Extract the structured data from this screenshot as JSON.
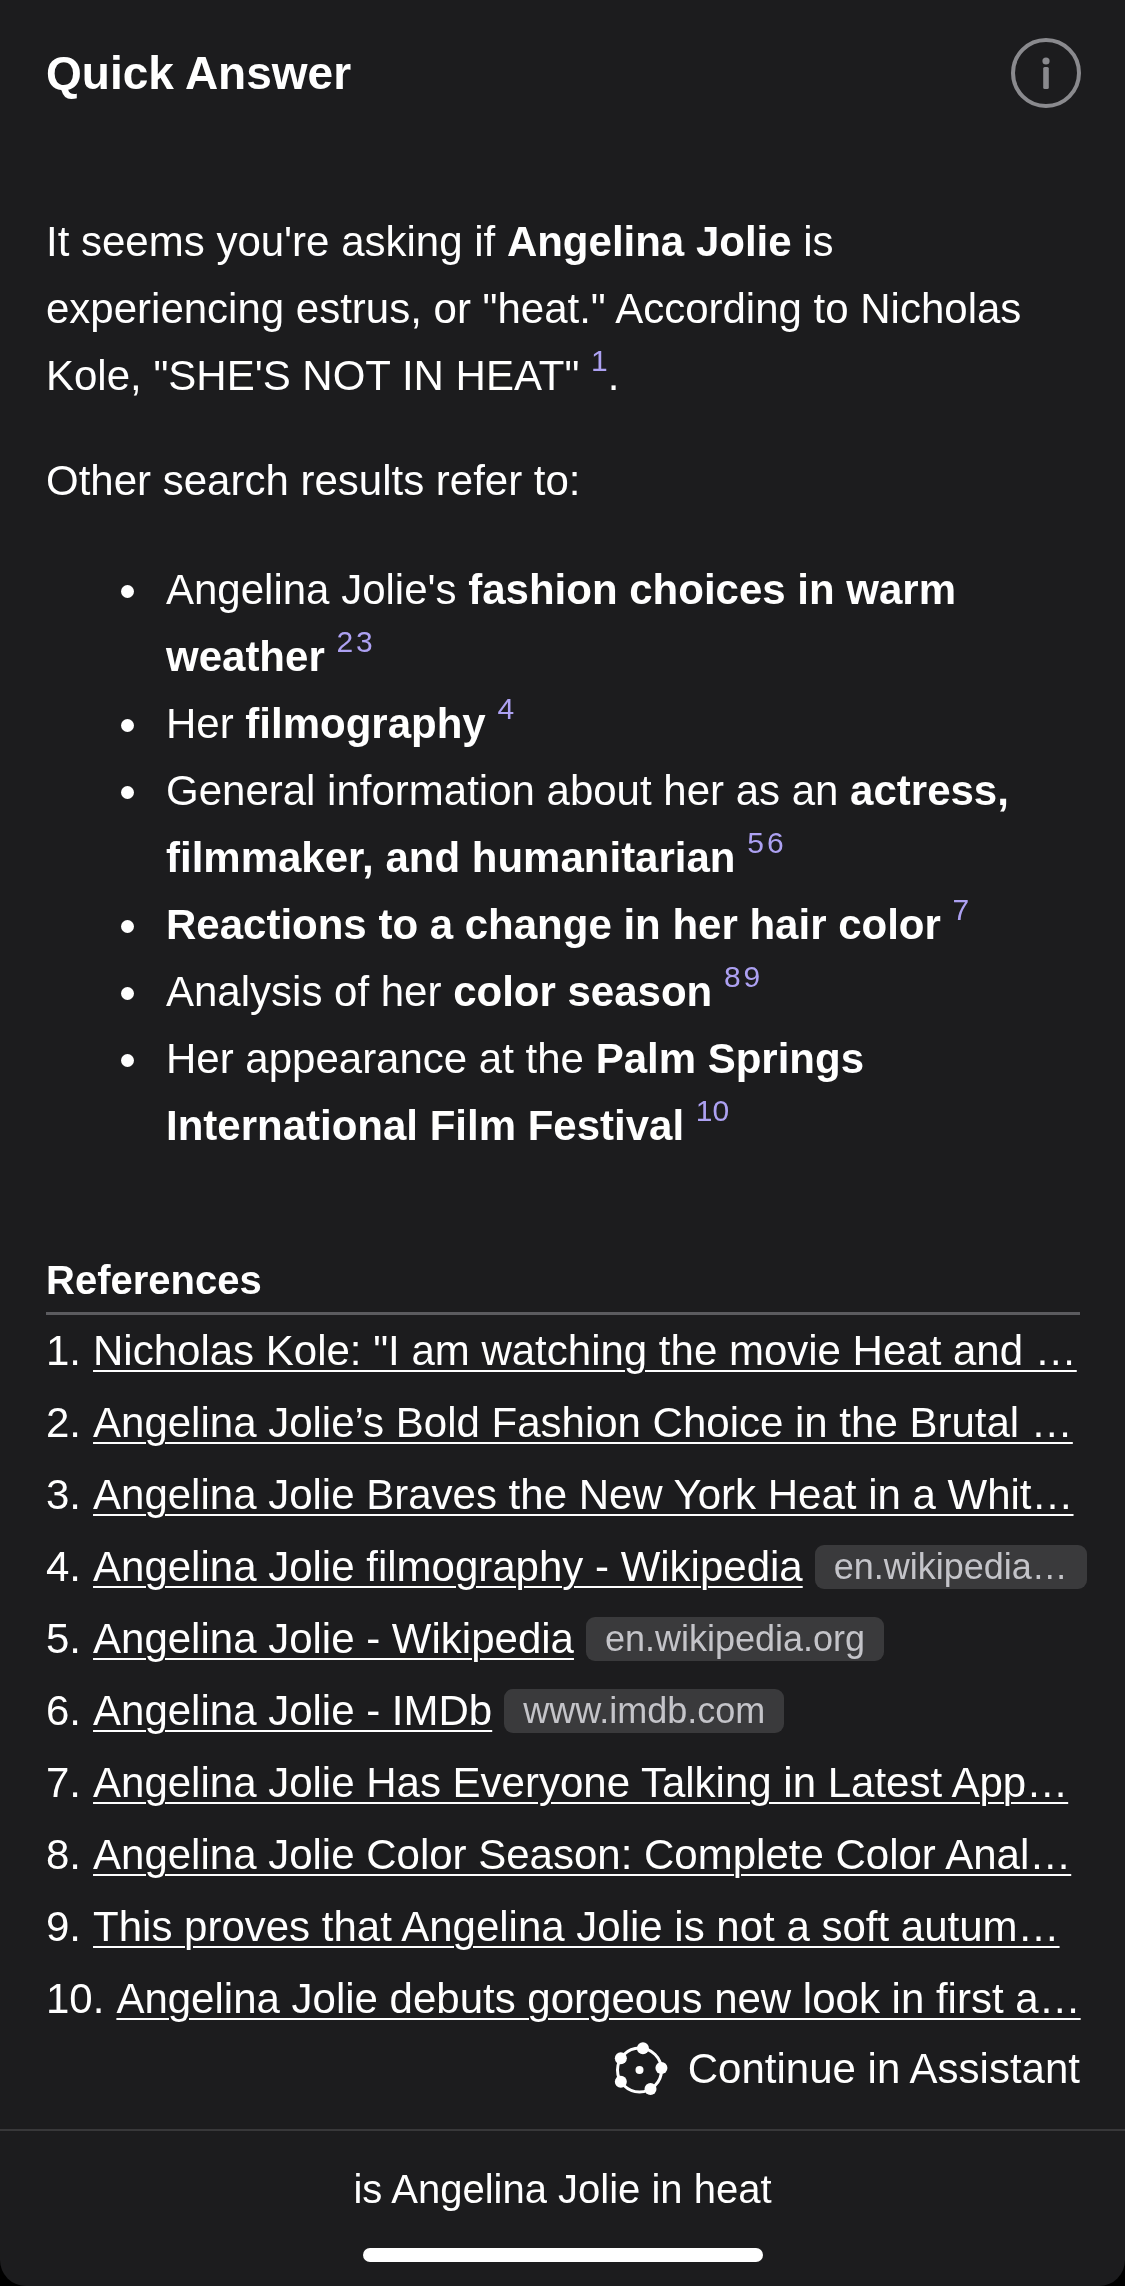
{
  "header": {
    "title": "Quick Answer"
  },
  "answer": {
    "paragraphs": [
      "It seems you're asking if **Angelina Jolie** is experiencing estrus, or \"heat.\" According to Nicholas Kole, \"SHE'S NOT IN HEAT\" $^{1}$.",
      "Other search results refer to:"
    ],
    "bullets": [
      "Angelina Jolie's **fashion choices in warm weather** $^{2}$$^{3}$",
      "Her **filmography** $^{4}$",
      "General information about her as an **actress, filmmaker, and humanitarian** $^{5}$$^{6}$",
      "**Reactions to a change in her hair color** $^{7}$",
      "Analysis of her **color season** $^{8}$$^{9}$",
      "Her appearance at the **Palm Springs International Film Festival** $^{10}$"
    ]
  },
  "references": {
    "heading": "References",
    "items": [
      {
        "number": "1.",
        "title": "Nicholas Kole: \"I am watching the movie Heat and …"
      },
      {
        "number": "2.",
        "title": "Angelina Jolie’s Bold Fashion Choice in the Brutal …"
      },
      {
        "number": "3.",
        "title": "Angelina Jolie Braves the New York Heat in a Whit…"
      },
      {
        "number": "4.",
        "title": "Angelina Jolie filmography - Wikipedia",
        "domain": "en.wikipedia…"
      },
      {
        "number": "5.",
        "title": "Angelina Jolie - Wikipedia",
        "domain": "en.wikipedia.org"
      },
      {
        "number": "6.",
        "title": "Angelina Jolie - IMDb",
        "domain": "www.imdb.com"
      },
      {
        "number": "7.",
        "title": "Angelina Jolie Has Everyone Talking in Latest App…"
      },
      {
        "number": "8.",
        "title": "Angelina Jolie Color Season: Complete Color Anal…"
      },
      {
        "number": "9.",
        "title": "This proves that Angelina Jolie is not a soft autum…"
      },
      {
        "number": "10.",
        "title": "Angelina Jolie debuts gorgeous new look in first a…"
      }
    ]
  },
  "continue_button": {
    "label": "Continue in Assistant"
  },
  "query_bar": {
    "query": "is Angelina Jolie in heat"
  }
}
